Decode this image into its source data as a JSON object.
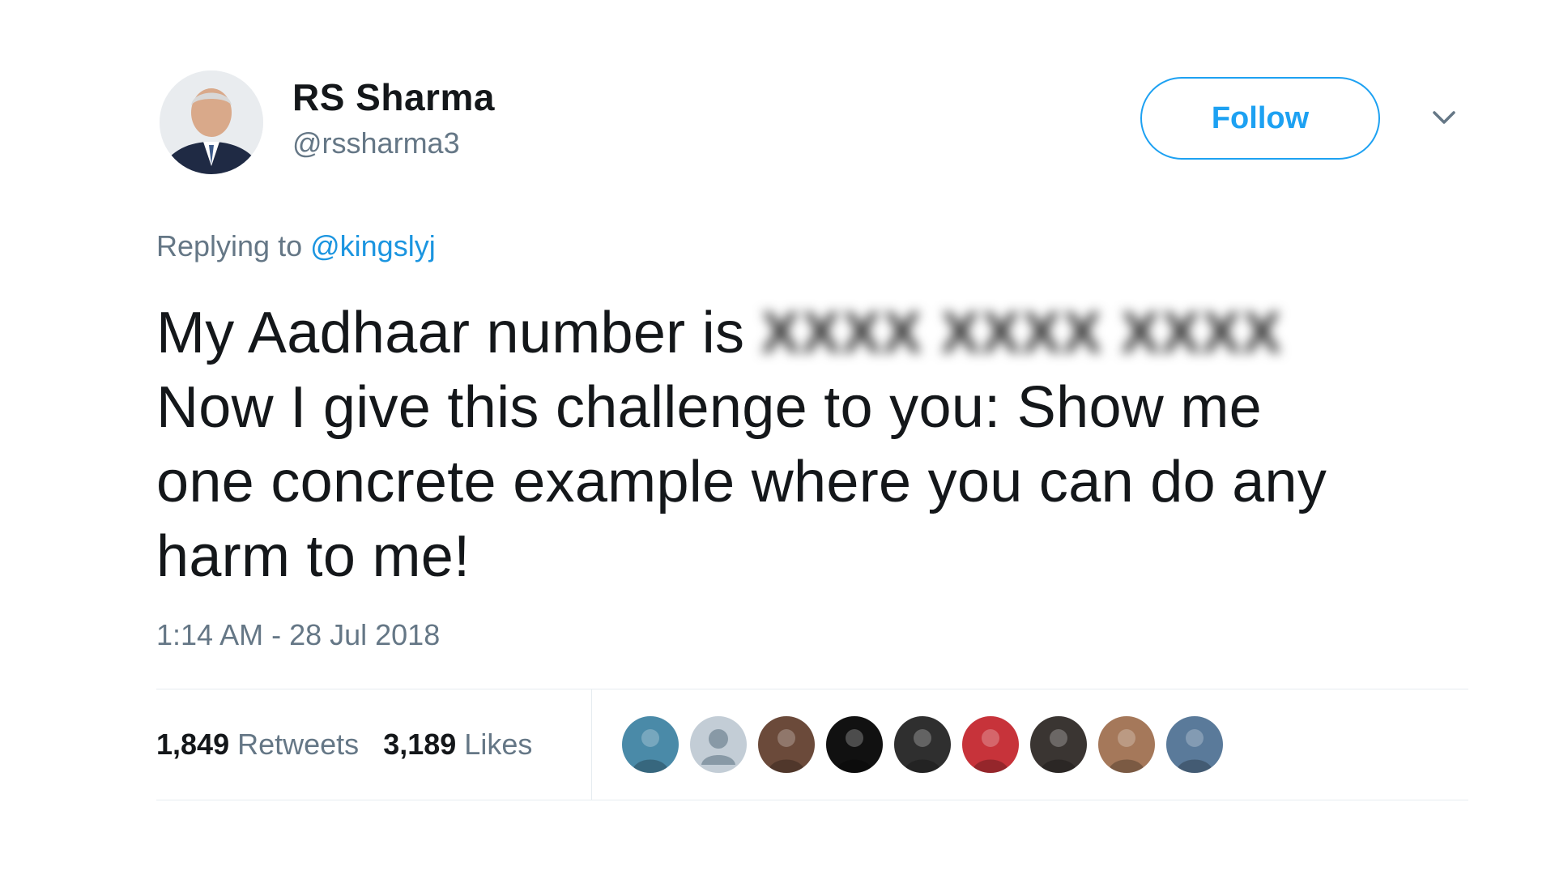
{
  "author": {
    "display_name": "RS Sharma",
    "handle": "@rssharma3"
  },
  "follow_label": "Follow",
  "reply": {
    "prefix": "Replying to ",
    "mention": "@kingslyj"
  },
  "tweet": {
    "line1_prefix": "My Aadhaar number is ",
    "line1_blurred": "XXXX XXXX XXXX",
    "line2": "Now I give this challenge to you: Show me",
    "line3": "one concrete example where you can do any",
    "line4": "harm to me!"
  },
  "timestamp": "1:14 AM - 28 Jul 2018",
  "stats": {
    "retweets_count": "1,849",
    "retweets_label": "Retweets",
    "likes_count": "3,189",
    "likes_label": "Likes"
  },
  "likers": [
    {
      "icon": "liker-avatar-pool",
      "color": "#4a8aa8"
    },
    {
      "icon": "liker-avatar-default",
      "color": "#c3cdd6"
    },
    {
      "icon": "liker-avatar-portrait",
      "color": "#6b4a3a"
    },
    {
      "icon": "liker-avatar-logo",
      "color": "#111111"
    },
    {
      "icon": "liker-avatar-portrait-dark",
      "color": "#2f2f2f"
    },
    {
      "icon": "liker-avatar-red",
      "color": "#c7333a"
    },
    {
      "icon": "liker-avatar-dark",
      "color": "#3a3532"
    },
    {
      "icon": "liker-avatar-face",
      "color": "#a5785a"
    },
    {
      "icon": "liker-avatar-cyclist",
      "color": "#5a7a9a"
    }
  ],
  "colors": {
    "accent": "#1da1f2",
    "link": "#1b95e0",
    "muted": "#657786",
    "text": "#14171a",
    "divider": "#e6ecf0"
  }
}
